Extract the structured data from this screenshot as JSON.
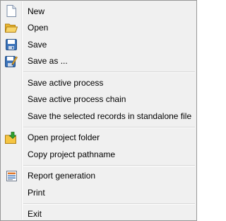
{
  "menu": {
    "groups": [
      [
        {
          "label": "New",
          "icon": "new-document-icon"
        },
        {
          "label": "Open",
          "icon": "open-folder-icon"
        },
        {
          "label": "Save",
          "icon": "floppy-disk-icon"
        },
        {
          "label": "Save as ...",
          "icon": "save-as-icon"
        }
      ],
      [
        {
          "label": "Save active process"
        },
        {
          "label": "Save active process chain"
        },
        {
          "label": "Save the selected records in standalone file"
        }
      ],
      [
        {
          "label": "Open project folder",
          "icon": "folder-arrow-icon"
        },
        {
          "label": "Copy project pathname"
        }
      ],
      [
        {
          "label": "Report generation",
          "icon": "report-icon"
        },
        {
          "label": "Print"
        }
      ],
      [
        {
          "label": "Exit"
        }
      ]
    ]
  },
  "colors": {
    "background": "#f0f0f0",
    "border": "#979797",
    "separator": "#d7d7d7",
    "folder_yellow": "#f5c542",
    "floppy_blue": "#3b73b9",
    "arrow_green": "#2fa32f",
    "report_orange": "#e0782d"
  }
}
